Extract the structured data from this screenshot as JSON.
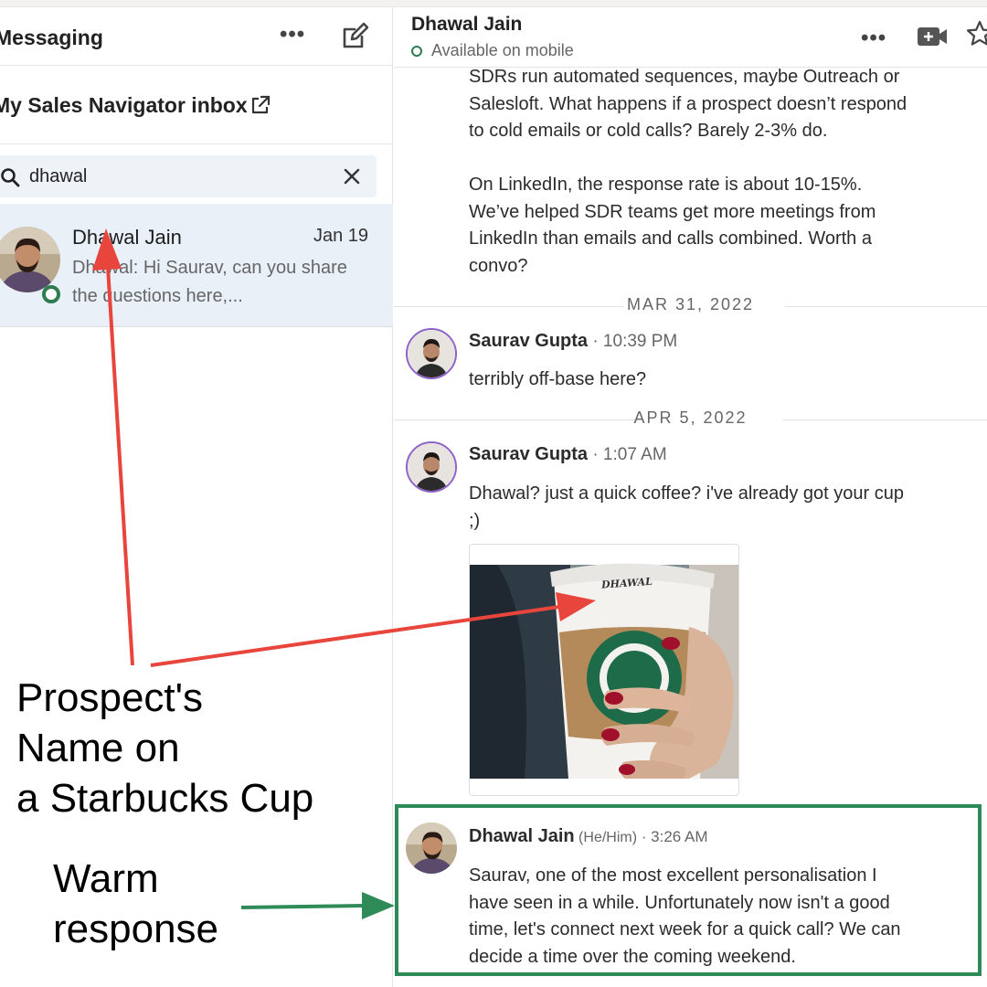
{
  "left": {
    "title": "Messaging",
    "inbox_label": "My Sales Navigator inbox",
    "search": {
      "value": "dhawal"
    },
    "conversation": {
      "name": "Dhawal Jain",
      "date": "Jan 19",
      "snippet": "Dhawal: Hi Saurav, can you share the questions here,..."
    }
  },
  "right": {
    "header": {
      "name": "Dhawal Jain",
      "status": "Available on mobile"
    },
    "earlier_message": [
      "SDRs run automated sequences, maybe Outreach or",
      "Salesloft. What happens if a prospect doesn’t respond",
      "to cold emails or cold calls? Barely 2-3% do.",
      "",
      "On LinkedIn, the response rate is about 10-15%.",
      "We’ve helped SDR teams get more meetings from",
      "LinkedIn than emails and calls combined. Worth a",
      "convo?"
    ],
    "date_1": "MAR 31, 2022",
    "msg_1": {
      "sender": "Saurav Gupta",
      "time": " · 10:39 PM",
      "text": "terribly off-base here?"
    },
    "date_2": "APR 5, 2022",
    "msg_2": {
      "sender": "Saurav Gupta",
      "time": " · 1:07 AM",
      "text_1": "Dhawal? just a quick coffee? i've already got your cup",
      "text_2": ";)"
    },
    "cup_name": "DHAWAL",
    "msg_3": {
      "sender": "Dhawal Jain",
      "pronouns": " (He/Him)",
      "time": " · 3:26 AM",
      "lines": [
        "Saurav, one of the most excellent personalisation I",
        "have seen in a while. Unfortunately now isn't a good",
        "time, let's connect next week for a quick call? We can",
        "decide a time over the coming weekend."
      ]
    }
  },
  "annotations": {
    "prospect": [
      "Prospect's",
      "Name on",
      "a Starbucks Cup"
    ],
    "warm": [
      "Warm",
      "response"
    ],
    "colors": {
      "red": "#e8453c",
      "green": "#2e8b57"
    }
  }
}
